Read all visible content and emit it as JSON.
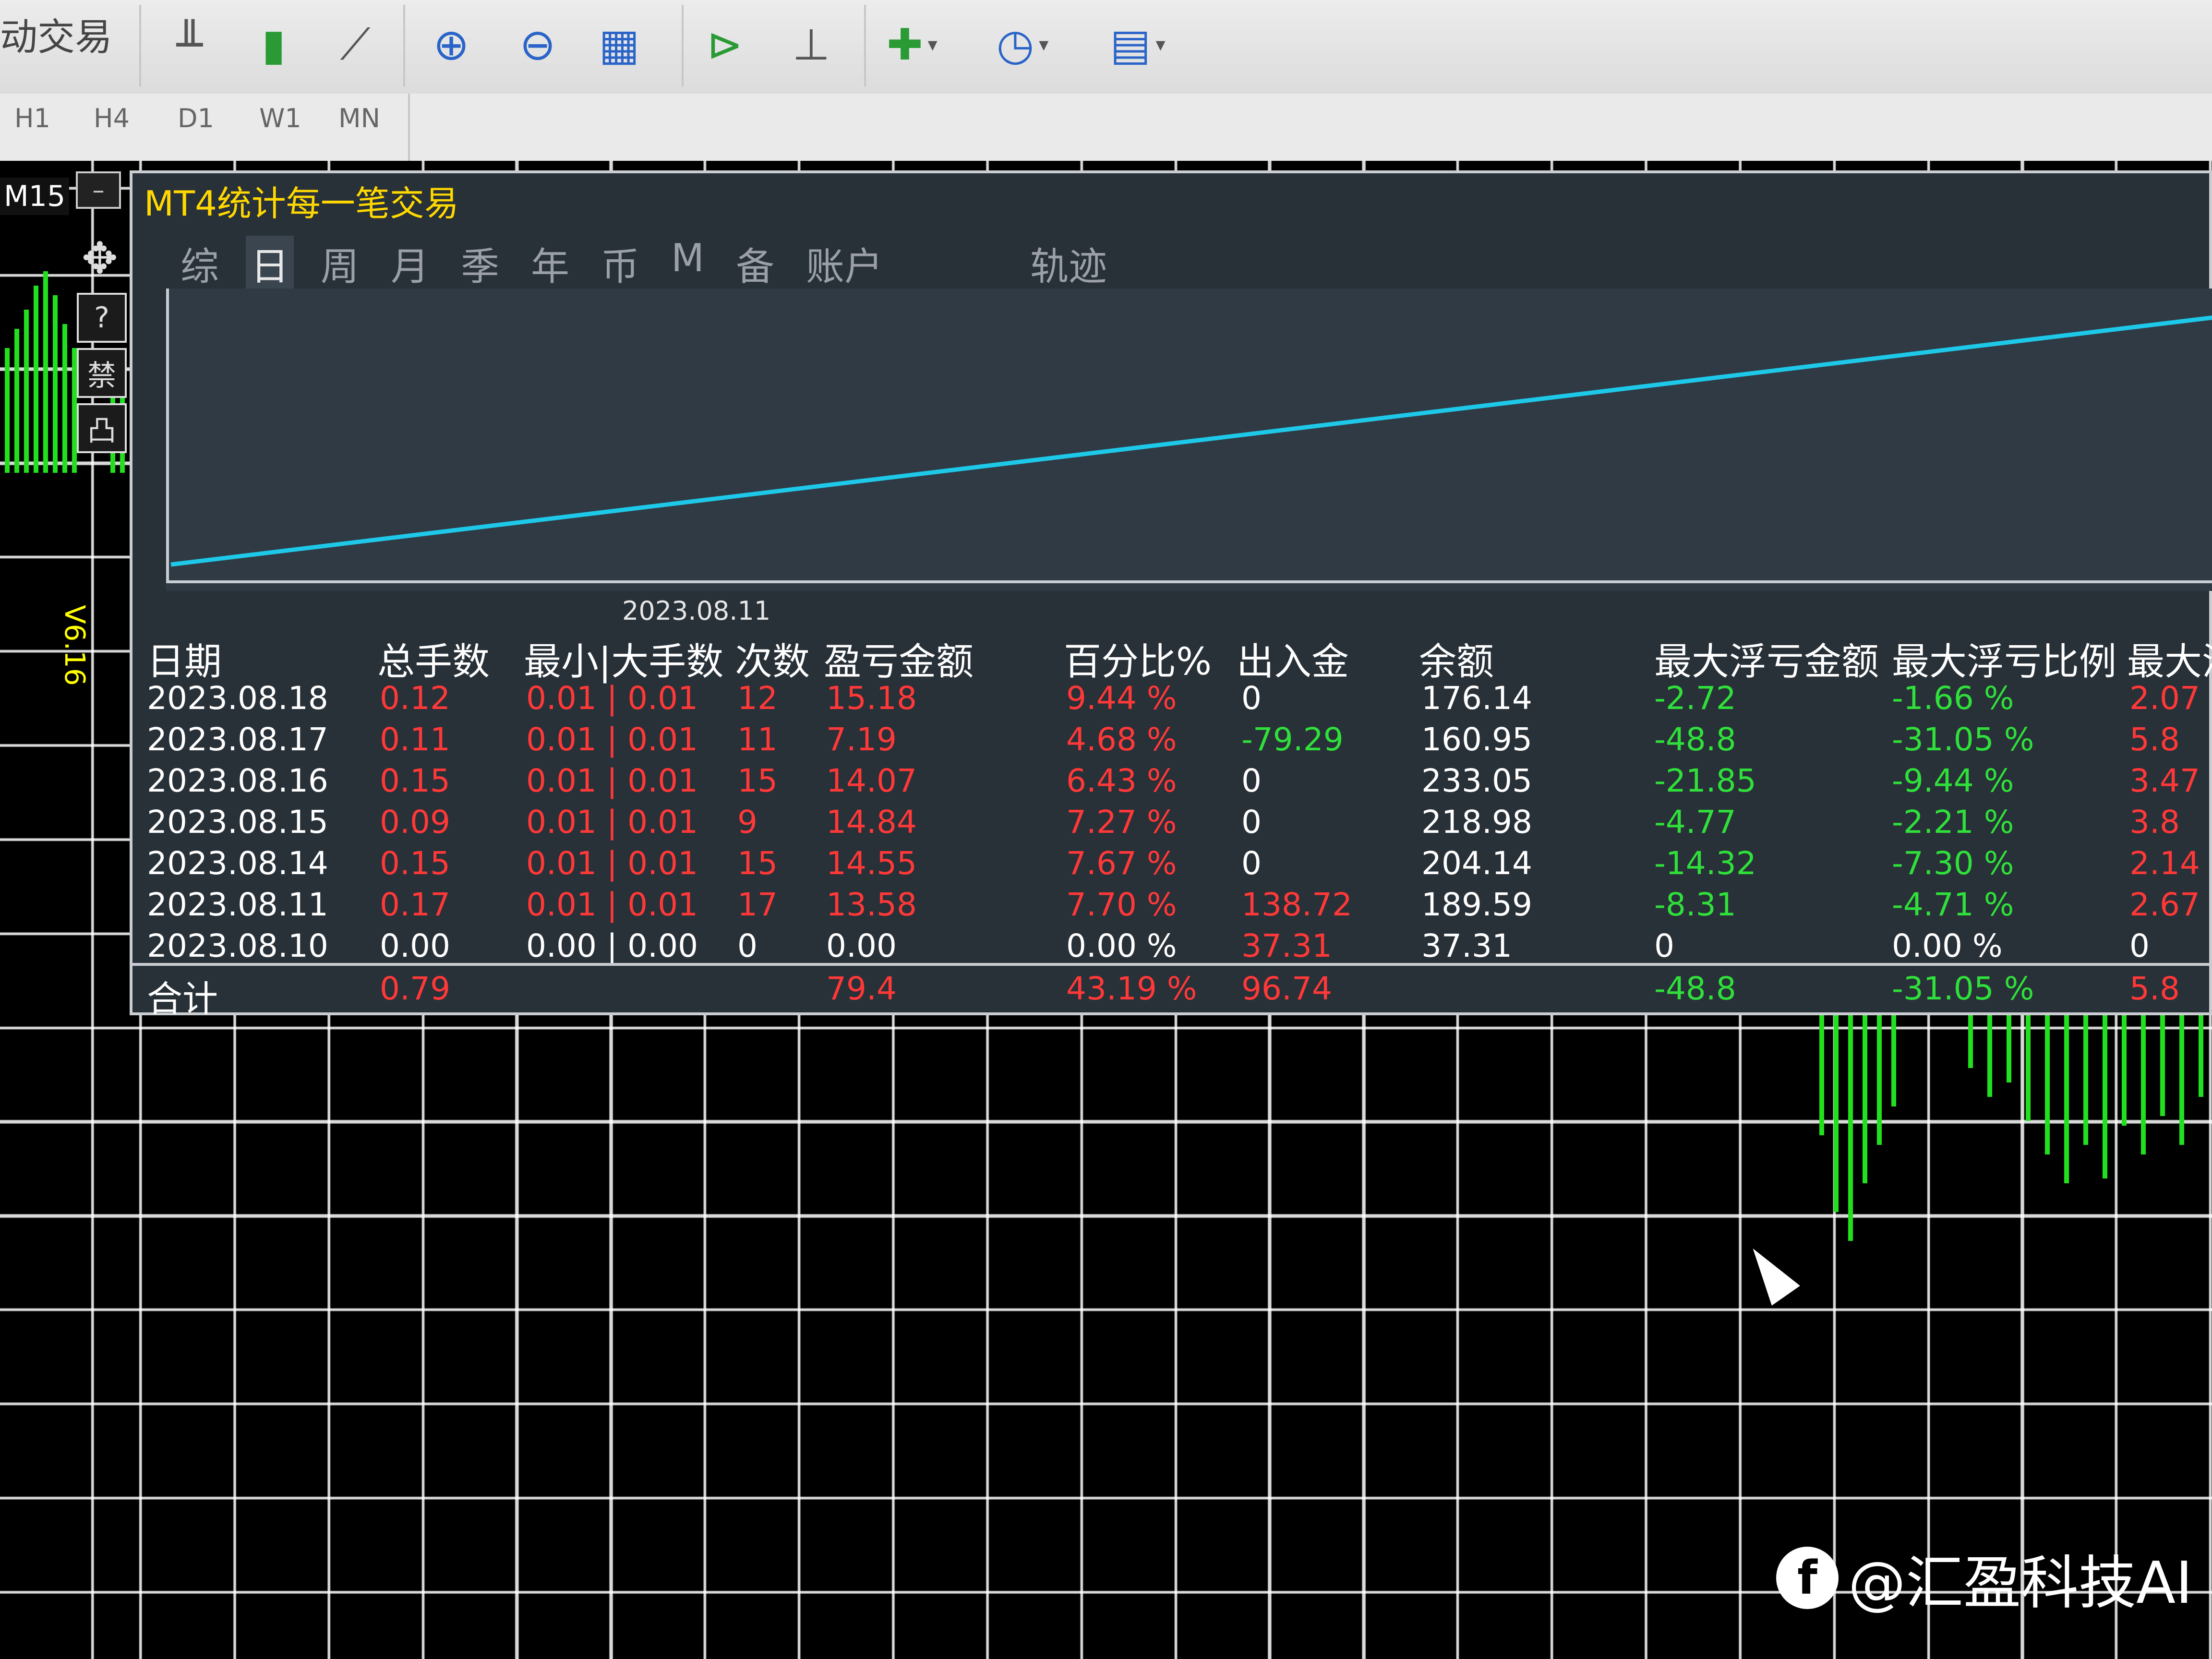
{
  "toolbar": {
    "left_label": "动交易",
    "icons": [
      "bar-chart-icon",
      "candlestick-icon",
      "line-chart-icon",
      "zoom-in-icon",
      "zoom-out-icon",
      "tile-windows-icon",
      "auto-scroll-icon",
      "chart-shift-icon",
      "indicators-icon",
      "periods-clock-icon",
      "templates-icon"
    ]
  },
  "timeframes": [
    "H1",
    "H4",
    "D1",
    "W1",
    "MN"
  ],
  "chart": {
    "period": "M15",
    "version": "V6.16",
    "side_buttons": [
      "✥",
      "?",
      "禁",
      "凸"
    ]
  },
  "panel": {
    "title": "MT4统计每一笔交易",
    "minimize_label": "–",
    "tabs": [
      "综",
      "日",
      "周",
      "月",
      "季",
      "年",
      "币",
      "M",
      "备",
      "账户"
    ],
    "active_tab": "日",
    "track_tab": "轨迹",
    "graph_date": "2023.08.11",
    "line_color": "#1ec8e8"
  },
  "table": {
    "headers": [
      "日期",
      "总手数",
      "最小|大手数",
      "次数",
      "盈亏金额",
      "百分比%",
      "出入金",
      "余额",
      "最大浮亏金额",
      "最大浮亏比例",
      "最大浮"
    ],
    "rows": [
      {
        "date": "2023.08.18",
        "lots": "0.12",
        "minmax": "0.01 | 0.01",
        "count": "12",
        "pl": "15.18",
        "pct": "9.44 %",
        "flow": "0",
        "balance": "176.14",
        "maxloss": "-2.72",
        "maxloss_pct": "-1.66 %",
        "last": "2.07"
      },
      {
        "date": "2023.08.17",
        "lots": "0.11",
        "minmax": "0.01 | 0.01",
        "count": "11",
        "pl": "7.19",
        "pct": "4.68 %",
        "flow": "-79.29",
        "balance": "160.95",
        "maxloss": "-48.8",
        "maxloss_pct": "-31.05 %",
        "last": "5.8"
      },
      {
        "date": "2023.08.16",
        "lots": "0.15",
        "minmax": "0.01 | 0.01",
        "count": "15",
        "pl": "14.07",
        "pct": "6.43 %",
        "flow": "0",
        "balance": "233.05",
        "maxloss": "-21.85",
        "maxloss_pct": "-9.44 %",
        "last": "3.47"
      },
      {
        "date": "2023.08.15",
        "lots": "0.09",
        "minmax": "0.01 | 0.01",
        "count": "9",
        "pl": "14.84",
        "pct": "7.27 %",
        "flow": "0",
        "balance": "218.98",
        "maxloss": "-4.77",
        "maxloss_pct": "-2.21 %",
        "last": "3.8"
      },
      {
        "date": "2023.08.14",
        "lots": "0.15",
        "minmax": "0.01 | 0.01",
        "count": "15",
        "pl": "14.55",
        "pct": "7.67 %",
        "flow": "0",
        "balance": "204.14",
        "maxloss": "-14.32",
        "maxloss_pct": "-7.30 %",
        "last": "2.14"
      },
      {
        "date": "2023.08.11",
        "lots": "0.17",
        "minmax": "0.01 | 0.01",
        "count": "17",
        "pl": "13.58",
        "pct": "7.70 %",
        "flow": "138.72",
        "balance": "189.59",
        "maxloss": "-8.31",
        "maxloss_pct": "-4.71 %",
        "last": "2.67"
      },
      {
        "date": "2023.08.10",
        "lots": "0.00",
        "minmax": "0.00 | 0.00",
        "count": "0",
        "pl": "0.00",
        "pct": "0.00 %",
        "flow": "37.31",
        "balance": "37.31",
        "maxloss": "0",
        "maxloss_pct": "0.00 %",
        "last": "0"
      }
    ],
    "total": {
      "label": "合计",
      "lots": "0.79",
      "pl": "79.4",
      "pct": "43.19 %",
      "flow": "96.74",
      "maxloss": "-48.8",
      "maxloss_pct": "-31.05 %",
      "last": "5.8"
    }
  },
  "watermark": {
    "logo": "f",
    "text": "@汇盈科技AI"
  }
}
